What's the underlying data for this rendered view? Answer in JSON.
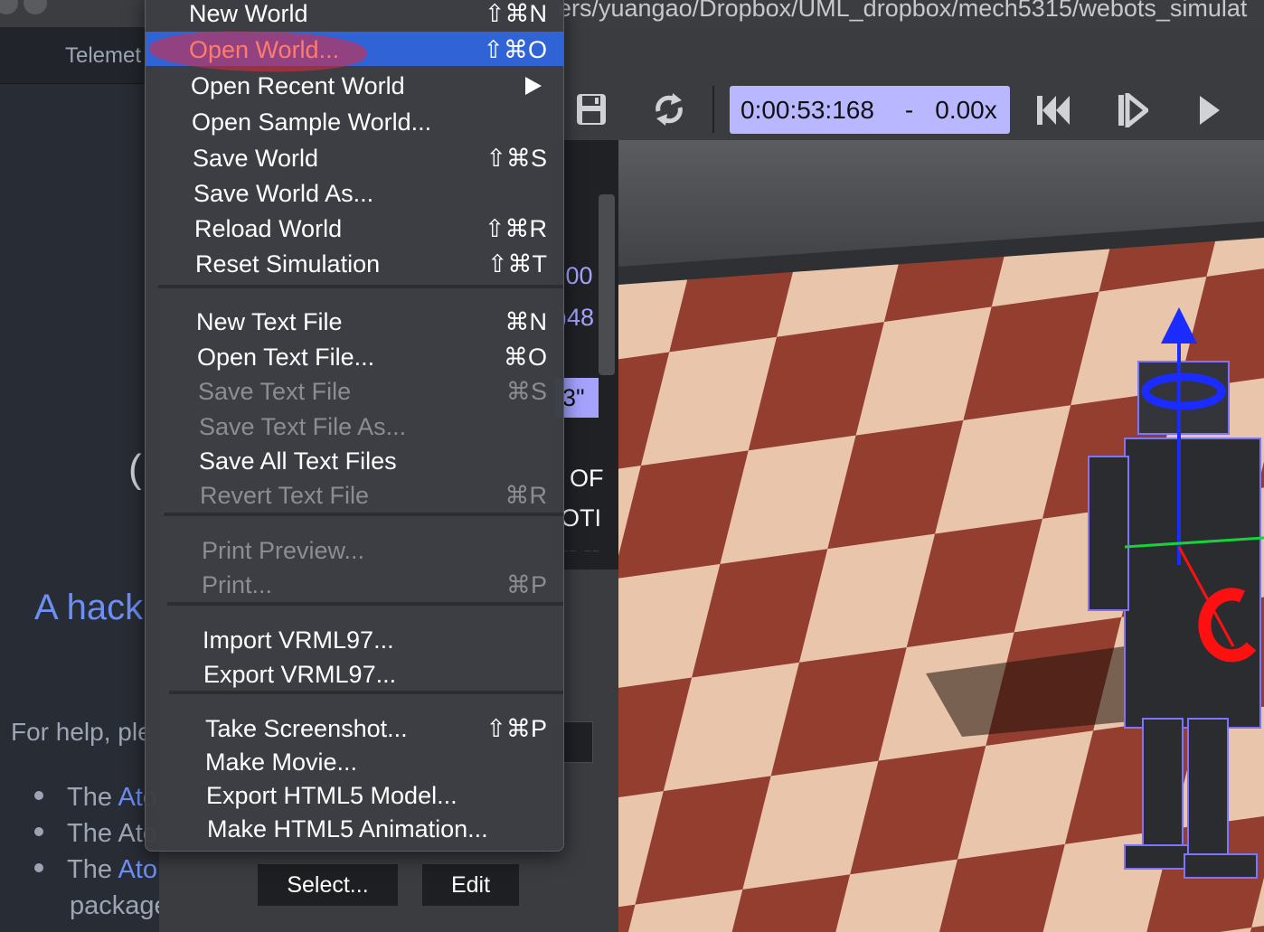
{
  "window": {
    "path": "ers/yuangao/Dropbox/UML_dropbox/mech5315/webots_simulat"
  },
  "atom": {
    "tab_label": "Telemet",
    "spinner": "(",
    "hack_title": "A hack",
    "help_text": "For help, ple",
    "bullets": [
      {
        "prefix": "The ",
        "link": "Ato"
      },
      {
        "prefix": "The Ato",
        "link": ""
      },
      {
        "prefix": "The ",
        "link": "Ato"
      }
    ],
    "package_text": "package"
  },
  "editor_fragments": [
    {
      "text": ".00",
      "color": "#a6a3ff"
    },
    {
      "text": ")48",
      "color": "#a6a3ff"
    },
    {
      "text": "3\"",
      "color": "#111111"
    },
    {
      "text": "OF",
      "color": "#ffffff"
    },
    {
      "text": "OTI",
      "color": "#ffffff"
    },
    {
      "text": "-- --",
      "color": "#ffffff"
    }
  ],
  "toolbar": {
    "icons": [
      "save-icon",
      "reload-icon",
      "skip-back-icon",
      "step-icon",
      "play-icon"
    ],
    "time": "0:00:53:168",
    "time_separator": "-",
    "speed": "0.00x"
  },
  "buttons": {
    "select_label": "Select...",
    "edit_label": "Edit"
  },
  "menu": {
    "sections": [
      [
        {
          "label": "New World",
          "shortcut": "⇧⌘N",
          "enabled": true
        },
        {
          "label": "Open World...",
          "shortcut": "⇧⌘O",
          "enabled": true,
          "highlighted": true
        },
        {
          "label": "Open Recent World",
          "shortcut": "",
          "enabled": true,
          "submenu": true
        },
        {
          "label": "Open Sample World...",
          "shortcut": "",
          "enabled": true
        },
        {
          "label": "Save World",
          "shortcut": "⇧⌘S",
          "enabled": true
        },
        {
          "label": "Save World As...",
          "shortcut": "",
          "enabled": true
        },
        {
          "label": "Reload World",
          "shortcut": "⇧⌘R",
          "enabled": true
        },
        {
          "label": "Reset Simulation",
          "shortcut": "⇧⌘T",
          "enabled": true
        }
      ],
      [
        {
          "label": "New Text File",
          "shortcut": "⌘N",
          "enabled": true
        },
        {
          "label": "Open Text File...",
          "shortcut": "⌘O",
          "enabled": true
        },
        {
          "label": "Save Text File",
          "shortcut": "⌘S",
          "enabled": false
        },
        {
          "label": "Save Text File As...",
          "shortcut": "",
          "enabled": false
        },
        {
          "label": "Save All Text Files",
          "shortcut": "",
          "enabled": true
        },
        {
          "label": "Revert Text File",
          "shortcut": "⌘R",
          "enabled": false
        }
      ],
      [
        {
          "label": "Print Preview...",
          "shortcut": "",
          "enabled": false
        },
        {
          "label": "Print...",
          "shortcut": "⌘P",
          "enabled": false
        }
      ],
      [
        {
          "label": "Import VRML97...",
          "shortcut": "",
          "enabled": true
        },
        {
          "label": "Export VRML97...",
          "shortcut": "",
          "enabled": true
        }
      ],
      [
        {
          "label": "Take Screenshot...",
          "shortcut": "⇧⌘P",
          "enabled": true
        },
        {
          "label": "Make Movie...",
          "shortcut": "",
          "enabled": true
        },
        {
          "label": "Export HTML5 Model...",
          "shortcut": "",
          "enabled": true
        },
        {
          "label": "Make HTML5 Animation...",
          "shortcut": "",
          "enabled": true
        }
      ]
    ]
  },
  "colors": {
    "highlight": "#2f63d6",
    "time_box": "#b9b7ff",
    "floor_dark": "#8a2f20",
    "floor_light": "#e8c2a8",
    "robot_axis_up": "#1a2cff",
    "robot_axis_rot": "#ff1010"
  }
}
